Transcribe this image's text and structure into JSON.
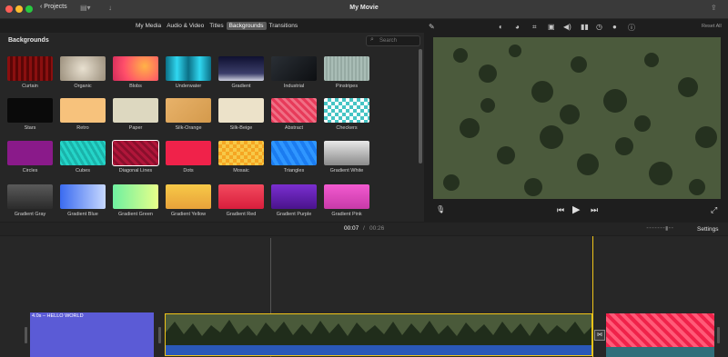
{
  "window": {
    "title": "My Movie",
    "projects_label": "Projects"
  },
  "tabs": [
    {
      "label": "My Media",
      "active": false
    },
    {
      "label": "Audio & Video",
      "active": false
    },
    {
      "label": "Titles",
      "active": false
    },
    {
      "label": "Backgrounds",
      "active": true
    },
    {
      "label": "Transitions",
      "active": false
    }
  ],
  "browser": {
    "section_title": "Backgrounds",
    "search_placeholder": "Search",
    "items": [
      {
        "label": "Curtain",
        "bg": "repeating-linear-gradient(90deg,#8a0f0f 0 3px,#5a0606 3px 6px)"
      },
      {
        "label": "Organic",
        "bg": "radial-gradient(circle,#e8e0d0,#9b8f7c)"
      },
      {
        "label": "Blobs",
        "bg": "radial-gradient(circle at 70% 40%,#ffb347,#ff4e6a 60%,#d02a5a)"
      },
      {
        "label": "Underwater",
        "bg": "linear-gradient(90deg,#0b6f86,#30d7f0,#0b6f86,#30d7f0,#0b6f86)"
      },
      {
        "label": "Gradient",
        "bg": "linear-gradient(#0f1030,#3b3e6a 70%,#cfd1e0)"
      },
      {
        "label": "Industrial",
        "bg": "linear-gradient(135deg,#2a2f35,#0d0f12)"
      },
      {
        "label": "Pinstripes",
        "bg": "repeating-linear-gradient(90deg,#a9bdb6 0 2px,#96aaa3 2px 4px)"
      },
      {
        "label": "Stars",
        "bg": "#0a0a0a"
      },
      {
        "label": "Retro",
        "bg": "#f7c27c"
      },
      {
        "label": "Paper",
        "bg": "#ddd8c0"
      },
      {
        "label": "Silk-Orange",
        "bg": "linear-gradient(135deg,#e8b26a,#d49a4c)"
      },
      {
        "label": "Silk-Beige",
        "bg": "#ece2c9"
      },
      {
        "label": "Abstract",
        "bg": "repeating-linear-gradient(45deg,#e73b5a 0 3px,#f06f85 3px 6px)"
      },
      {
        "label": "Checkers",
        "bg": "repeating-conic-gradient(#46c5c5 0 25%,#ffffff 0 50%) 0 0/8px 8px"
      },
      {
        "label": "Circles",
        "bg": "#8a1a8a"
      },
      {
        "label": "Cubes",
        "bg": "repeating-linear-gradient(60deg,#25d5c8 0 3px,#1ab3aa 3px 6px)"
      },
      {
        "label": "Diagonal Lines",
        "bg": "repeating-linear-gradient(45deg,#b0163a 0 3px,#8a0f2c 3px 6px)"
      },
      {
        "label": "Dots",
        "bg": "#f0224a"
      },
      {
        "label": "Mosaic",
        "bg": "repeating-conic-gradient(#f5a623 0 25%,#f7c948 0 50%) 0 0/8px 8px"
      },
      {
        "label": "Triangles",
        "bg": "repeating-linear-gradient(60deg,#1b7cf0 0 4px,#2f96ff 4px 8px)"
      },
      {
        "label": "Gradient White",
        "bg": "linear-gradient(#e8e8e8,#8a8a8a)"
      },
      {
        "label": "Gradient Gray",
        "bg": "linear-gradient(#5a5a5a,#2b2b2b)"
      },
      {
        "label": "Gradient Blue",
        "bg": "linear-gradient(90deg,#3a6bf0,#c7d8ff)"
      },
      {
        "label": "Gradient Green",
        "bg": "linear-gradient(90deg,#6ef0a0,#e8ff8a)"
      },
      {
        "label": "Gradient Yellow",
        "bg": "linear-gradient(#f7c948,#e8a23a)"
      },
      {
        "label": "Gradient Red",
        "bg": "linear-gradient(#f24a5e,#d81e3c)"
      },
      {
        "label": "Gradient Purple",
        "bg": "linear-gradient(#7a2fd0,#4a148c)"
      },
      {
        "label": "Gradient Pink",
        "bg": "linear-gradient(#f25ad0,#c83aa8)"
      }
    ]
  },
  "viewer": {
    "reset_label": "Reset All"
  },
  "timecode": {
    "current": "00:07",
    "separator": "/",
    "total": "00:26"
  },
  "settings_label": "Settings",
  "timeline": {
    "title_clip_label": "4.0s – HELLO WORLD"
  },
  "colors": {
    "accent": "#f0c419",
    "title_clip": "#5b5bd6"
  }
}
